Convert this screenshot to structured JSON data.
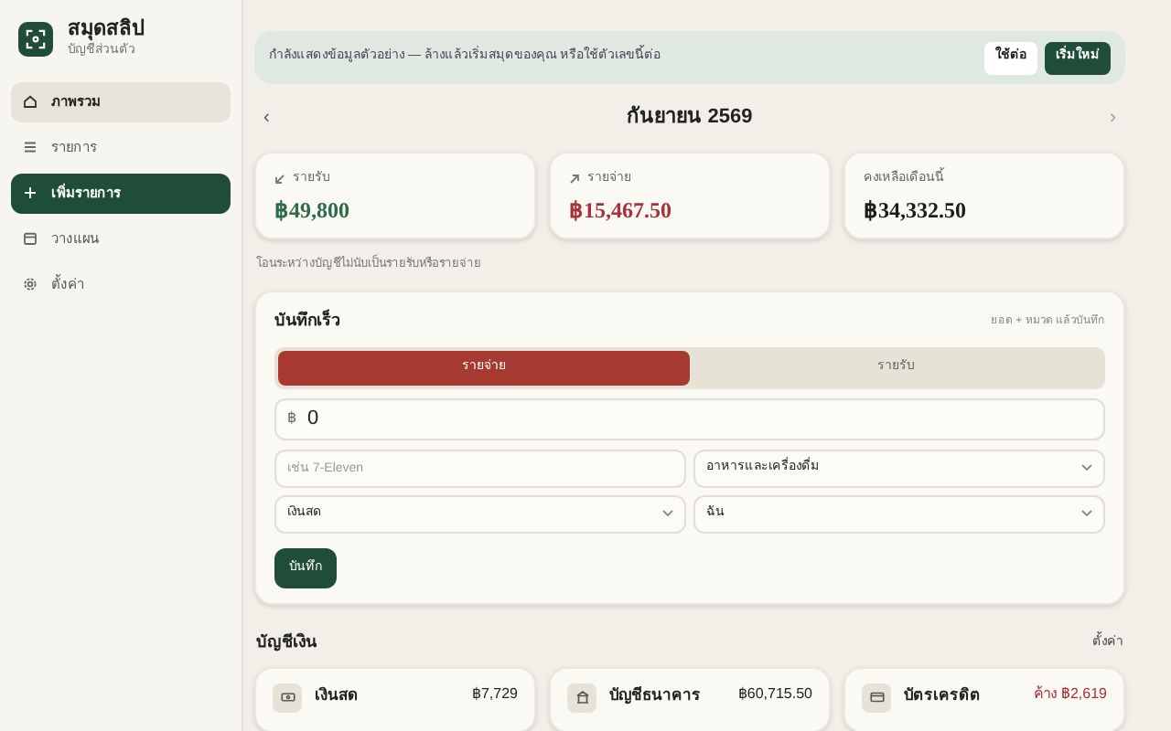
{
  "app": {
    "name": "สมุดสลิป",
    "subtitle": "บัญชีส่วนตัว"
  },
  "nav": [
    {
      "label": "ภาพรวม",
      "kind": "link",
      "selected": true
    },
    {
      "label": "รายการ",
      "kind": "link",
      "selected": false
    },
    {
      "label": "เพิ่มรายการ",
      "kind": "primary",
      "selected": false
    },
    {
      "label": "วางแผน",
      "kind": "link",
      "selected": false
    },
    {
      "label": "ตั้งค่า",
      "kind": "link",
      "selected": false
    }
  ],
  "banner": {
    "text": "กำลังแสดงข้อมูลตัวอย่าง — ล้างแล้วเริ่มสมุดของคุณ หรือใช้ตัวเลขนี้ต่อ",
    "buttons": [
      {
        "label": "ใช้ต่อ",
        "kind": "secondary"
      },
      {
        "label": "เริ่มใหม่",
        "kind": "primary"
      }
    ]
  },
  "month": {
    "prev": "‹",
    "label": "กันยายน 2569",
    "next": "›"
  },
  "summary": [
    {
      "label": "รายรับ",
      "value": "฿49,800",
      "kind": "income"
    },
    {
      "label": "รายจ่าย",
      "value": "฿15,467.50",
      "kind": "expense"
    },
    {
      "label": "คงเหลือเดือนนี้",
      "value": "฿34,332.50",
      "kind": "balance"
    }
  ],
  "note": "โอนระหว่างบัญชีไม่นับเป็นรายรับหรือรายจ่าย",
  "quick": {
    "title": "บันทึกเร็ว",
    "hint": "ยอด + หมวด แล้วบันทึก",
    "tabs": [
      {
        "label": "รายจ่าย",
        "selected": true
      },
      {
        "label": "รายรับ",
        "selected": false
      }
    ],
    "currency": "฿",
    "amount": "0",
    "placeholder": "เช่น 7-Eleven",
    "category": "อาหารและเครื่องดื่ม",
    "account": "เงินสด",
    "person": "ฉัน",
    "save": "บันทึก"
  },
  "accounts": {
    "title": "บัญชีเงิน",
    "link": "ตั้งค่า",
    "items": [
      {
        "name": "เงินสด",
        "balance": "฿7,729",
        "owed": false
      },
      {
        "name": "บัญชีธนาคาร",
        "balance": "฿60,715.50",
        "owed": false
      },
      {
        "name": "บัตรเครดิต",
        "balance": "ค้าง ฿2,619",
        "owed": true
      }
    ]
  }
}
